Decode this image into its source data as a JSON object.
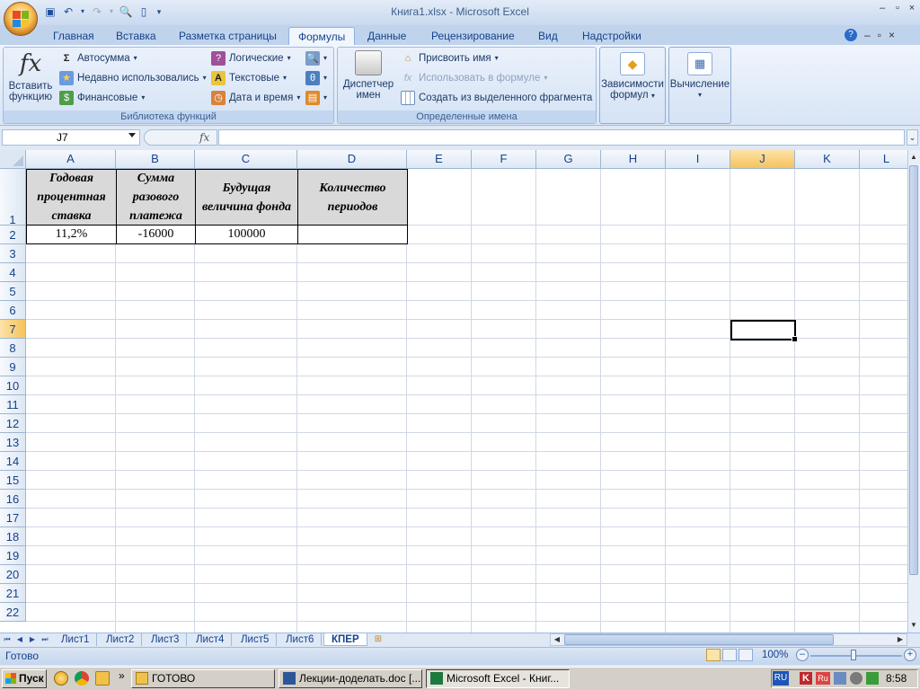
{
  "window": {
    "title": "Книга1.xlsx - Microsoft Excel",
    "controls": [
      "–",
      "▫",
      "×"
    ]
  },
  "ribbon_tabs": [
    "Главная",
    "Вставка",
    "Разметка страницы",
    "Формулы",
    "Данные",
    "Рецензирование",
    "Вид",
    "Надстройки"
  ],
  "active_tab": "Формулы",
  "ribbon": {
    "insert_function": {
      "line1": "Вставить",
      "line2": "функцию"
    },
    "library": {
      "autosum": "Автосумма",
      "recent": "Недавно использовались",
      "financial": "Финансовые",
      "logical": "Логические",
      "text": "Текстовые",
      "datetime": "Дата и время",
      "label": "Библиотека функций"
    },
    "names": {
      "manager_line1": "Диспетчер",
      "manager_line2": "имен",
      "assign_name": "Присвоить имя",
      "use_in_formula": "Использовать в формуле",
      "create_from_selection": "Создать из выделенного фрагмента",
      "label": "Определенные имена"
    },
    "dependencies": {
      "line1": "Зависимости",
      "line2": "формул"
    },
    "calculation": {
      "line1": "Вычисление"
    }
  },
  "formula_bar": {
    "name_box": "J7",
    "fx": "fx",
    "value": ""
  },
  "grid": {
    "columns": [
      "A",
      "B",
      "C",
      "D",
      "E",
      "F",
      "G",
      "H",
      "I",
      "J",
      "K",
      "L"
    ],
    "rows": [
      "1",
      "2",
      "3",
      "4",
      "5",
      "6",
      "7",
      "8",
      "9",
      "10",
      "11",
      "12",
      "13",
      "14",
      "15",
      "16",
      "17",
      "18",
      "19",
      "20",
      "21",
      "22"
    ],
    "selected_column": "J",
    "selected_row": "7",
    "header_cells": {
      "A1": "Годовая процентная ставка",
      "B1": "Сумма разового платежа",
      "C1": "Будущая величина фонда",
      "D1": "Количество периодов"
    },
    "data_cells": {
      "A2": "11,2%",
      "B2": "-16000",
      "C2": "100000",
      "D2": ""
    }
  },
  "sheets": [
    "Лист1",
    "Лист2",
    "Лист3",
    "Лист4",
    "Лист5",
    "Лист6",
    "КПЕР"
  ],
  "active_sheet": "КПЕР",
  "status": {
    "text": "Готово",
    "zoom": "100%"
  },
  "taskbar": {
    "start": "Пуск",
    "tasks": [
      "ГОТОВО",
      "Лекции-доделать.doc [...",
      "Microsoft Excel - Книг..."
    ],
    "lang": "RU",
    "clock": "8:58"
  },
  "colors": {
    "accent": "#15428b",
    "header_fill": "#d9d9d9",
    "selected_header": "#f5c35a"
  }
}
